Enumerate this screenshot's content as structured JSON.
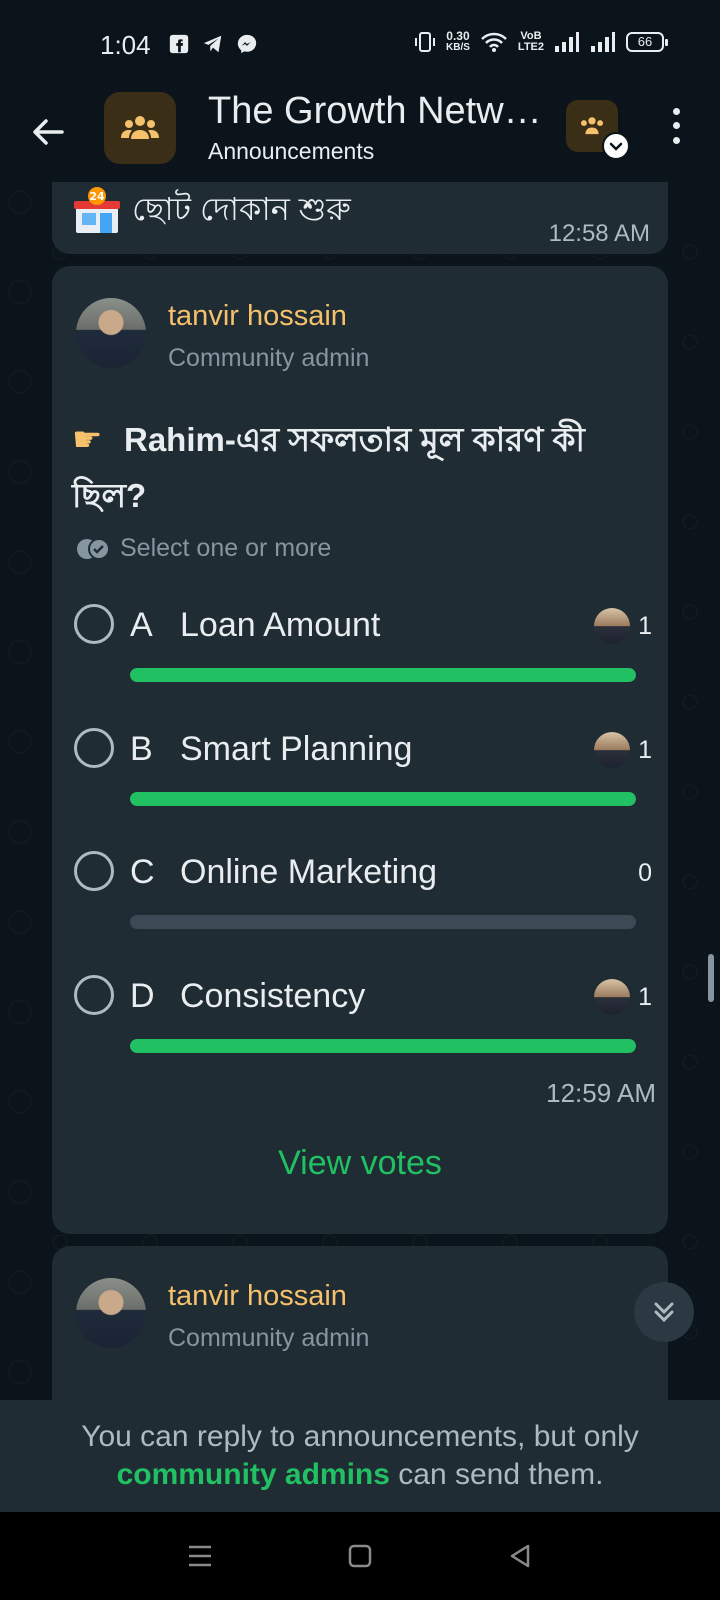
{
  "status_bar": {
    "time": "1:04",
    "net_speed_value": "0.30",
    "net_speed_unit": "KB/S",
    "volte_top": "VoB",
    "volte_bottom": "LTE2",
    "battery": "66"
  },
  "header": {
    "title": "The Growth Netw…",
    "subtitle": "Announcements"
  },
  "previous_message": {
    "text": "ছোট দোকান শুরু",
    "time": "12:58 AM"
  },
  "poll_message": {
    "sender": "tanvir hossain",
    "role": "Community admin",
    "question": "Rahim-এর সফলতার মূল কারণ কী ছিল?",
    "hint": "Select one or more",
    "options": [
      {
        "letter": "A",
        "label": "Loan Amount",
        "count": "1",
        "share": 1.0
      },
      {
        "letter": "B",
        "label": "Smart Planning",
        "count": "1",
        "share": 1.0
      },
      {
        "letter": "C",
        "label": "Online Marketing",
        "count": "0",
        "share": 0.0
      },
      {
        "letter": "D",
        "label": "Consistency",
        "count": "1",
        "share": 1.0
      }
    ],
    "time": "12:59 AM",
    "view_votes": "View votes"
  },
  "next_message": {
    "sender": "tanvir hossain",
    "role": "Community admin"
  },
  "footer_notice": {
    "before": "You can reply to announcements, but only",
    "link": "community admins",
    "after": "can send them."
  },
  "colors": {
    "accent_green": "#21c063",
    "sender_gold": "#f5c16c",
    "bubble_bg": "#1f2c33",
    "app_bg": "#0b141a"
  },
  "icons": {
    "back": "back-arrow-icon",
    "group": "group-icon",
    "community": "community-icon",
    "menu": "more-vert-icon",
    "scroll_down": "double-chevron-down-icon",
    "poll_hint": "double-check-icon"
  }
}
